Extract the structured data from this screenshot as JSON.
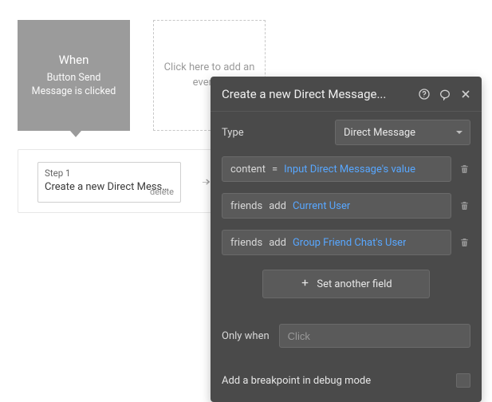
{
  "trigger": {
    "when_label": "When",
    "description": "Button Send Message is clicked"
  },
  "add_event": {
    "text": "Click here to add an event..."
  },
  "step": {
    "num_label": "Step 1",
    "title": "Create a new Direct Message...",
    "delete_label": "delete"
  },
  "panel": {
    "title": "Create a new Direct Message...",
    "type_label": "Type",
    "type_value": "Direct Message",
    "fields": [
      {
        "lhs": "content",
        "op": "=",
        "val": "Input Direct Message's value"
      },
      {
        "lhs": "friends",
        "op": "add",
        "val": "Current User"
      },
      {
        "lhs": "friends",
        "op": "add",
        "val": "Group Friend Chat's User"
      }
    ],
    "set_another_label": "Set another field",
    "only_when_label": "Only when",
    "only_when_placeholder": "Click",
    "breakpoint_label": "Add a breakpoint in debug mode"
  }
}
